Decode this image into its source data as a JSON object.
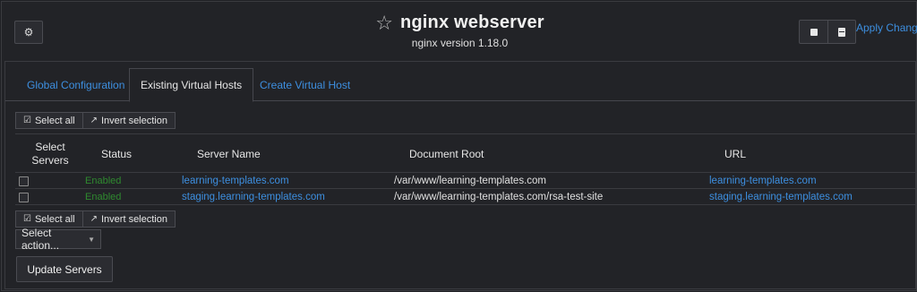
{
  "header": {
    "title": "nginx webserver",
    "subtitle": "nginx version 1.18.0",
    "apply_link": "Apply Changes"
  },
  "icons": {
    "settings": "gear-icon",
    "favorite": "star-icon",
    "stop": "stop-icon",
    "config": "book-icon"
  },
  "tabs": [
    {
      "label": "Global Configuration",
      "active": false
    },
    {
      "label": "Existing Virtual Hosts",
      "active": true
    },
    {
      "label": "Create Virtual Host",
      "active": false
    }
  ],
  "selection": {
    "select_all": "Select all",
    "invert": "Invert selection"
  },
  "table": {
    "headers": {
      "select": "Select Servers",
      "status": "Status",
      "server_name": "Server Name",
      "document_root": "Document Root",
      "url": "URL"
    },
    "rows": [
      {
        "status": "Enabled",
        "server_name": "learning-templates.com",
        "document_root": "/var/www/learning-templates.com",
        "url": "learning-templates.com"
      },
      {
        "status": "Enabled",
        "server_name": "staging.learning-templates.com",
        "document_root": "/var/www/learning-templates.com/rsa-test-site",
        "url": "staging.learning-templates.com"
      }
    ]
  },
  "actions": {
    "select_action": "Select action...",
    "update_button": "Update Servers"
  },
  "colors": {
    "link": "#3d8fe0",
    "enabled": "#2f8a2f",
    "background": "#222327"
  }
}
